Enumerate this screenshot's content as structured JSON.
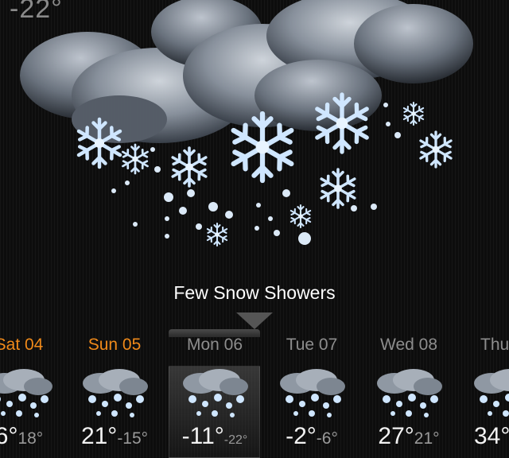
{
  "current": {
    "temperature": "-22°",
    "condition": "Few Snow Showers",
    "icon": "snow-showers-icon"
  },
  "forecast": [
    {
      "day": "Sat 04",
      "high": "6°",
      "low": "18°",
      "weekend": true,
      "icon": "snow-showers-icon"
    },
    {
      "day": "Sun 05",
      "high": "21°",
      "low": "-15°",
      "weekend": true,
      "icon": "snow-showers-icon"
    },
    {
      "day": "Mon 06",
      "high": "-11°",
      "low": "-22°",
      "weekend": false,
      "selected": true,
      "icon": "snow-showers-icon"
    },
    {
      "day": "Tue 07",
      "high": "-2°",
      "low": "-6°",
      "weekend": false,
      "icon": "snow-showers-icon"
    },
    {
      "day": "Wed 08",
      "high": "27°",
      "low": "21°",
      "weekend": false,
      "icon": "snow-showers-icon"
    },
    {
      "day": "Thu",
      "high": "34°",
      "low": "",
      "weekend": false,
      "icon": "snow-showers-icon"
    }
  ],
  "colors": {
    "weekend": "#f08a1a",
    "weekday": "#8d8d8d",
    "background": "#0d0d0d"
  }
}
